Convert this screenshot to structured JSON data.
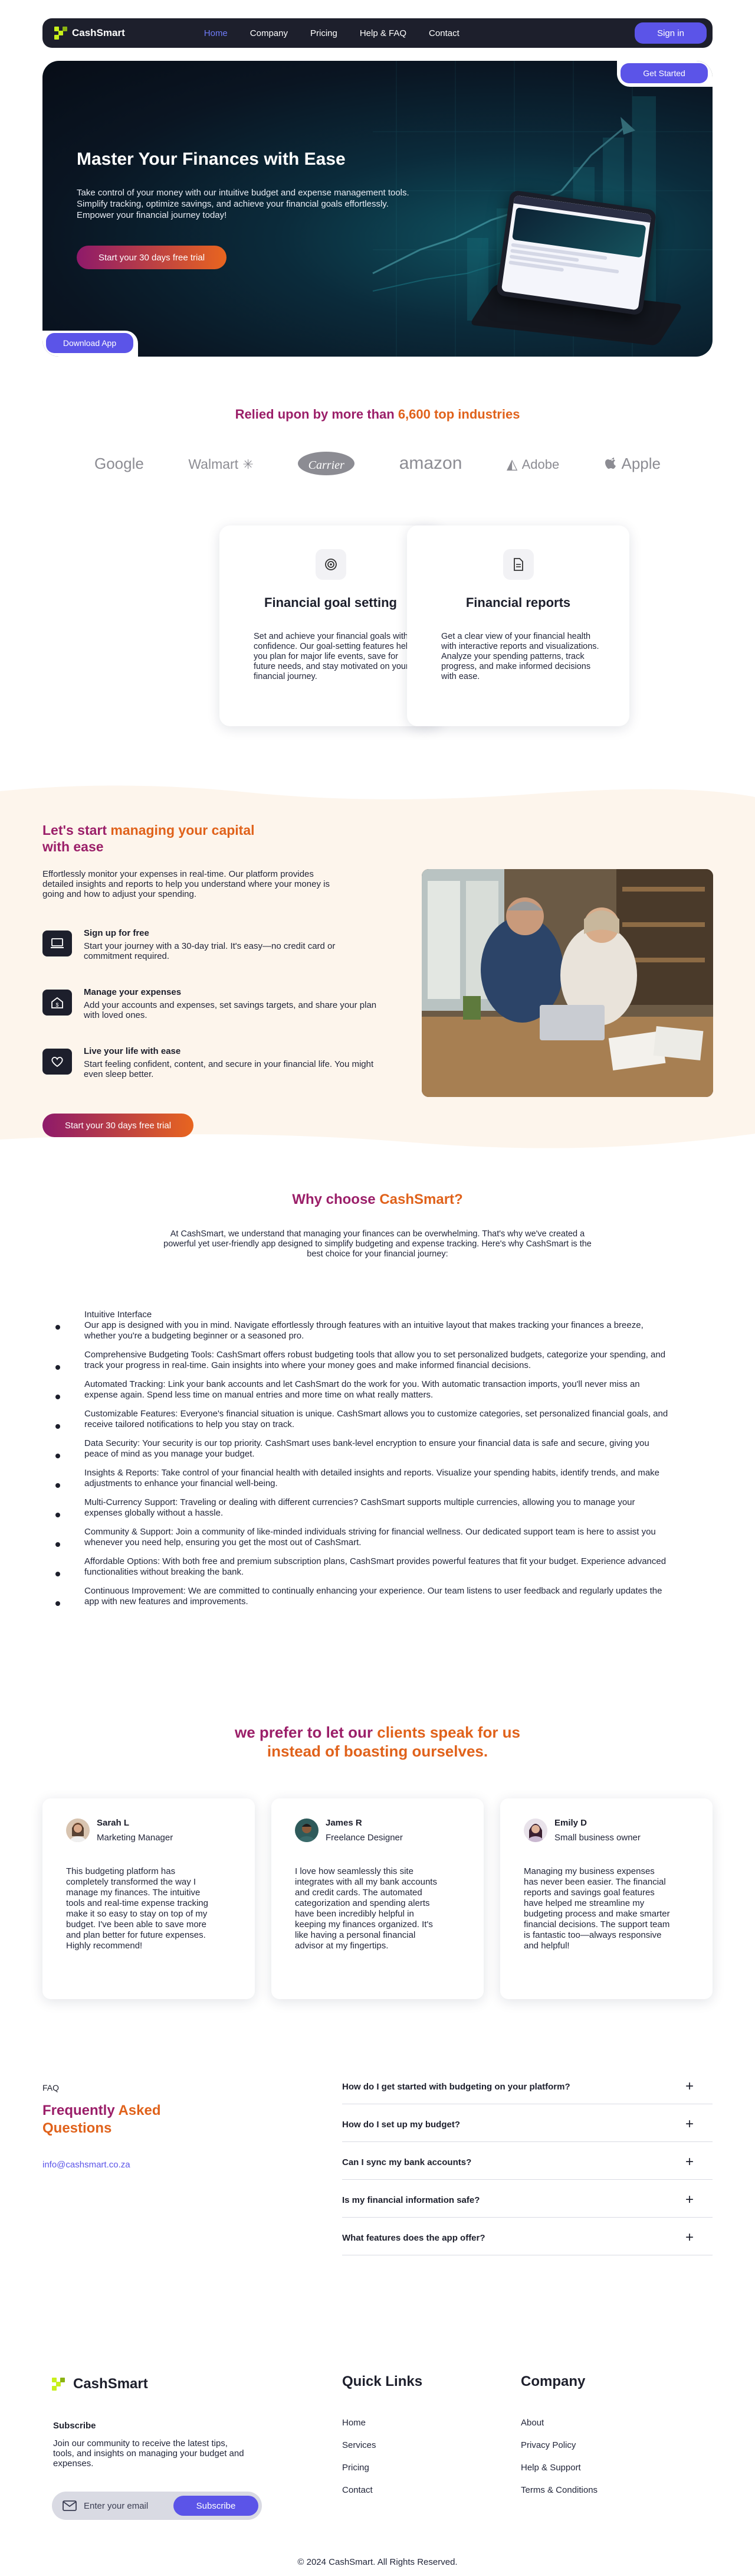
{
  "nav": {
    "brand": "CashSmart",
    "links": [
      "Home",
      "Company",
      "Pricing",
      "Help & FAQ",
      "Contact"
    ],
    "signin": "Sign in"
  },
  "hero": {
    "title": "Master Your Finances with Ease",
    "text": "Take control of your money with our intuitive budget and expense management tools. Simplify tracking, optimize savings, and achieve your financial goals effortlessly. Empower your financial journey today!",
    "cta": "Start your 30 days free trial",
    "get_started": "Get Started",
    "download_app": "Download App"
  },
  "trust": {
    "title_a": "Relied upon by more than ",
    "title_b": "6,600 top industries",
    "logos": [
      "Google",
      "Walmart",
      "Carrier",
      "amazon",
      "Adobe",
      "Apple"
    ]
  },
  "features": [
    {
      "title": "Financial goal setting",
      "text": "Set and achieve your financial goals with confidence. Our goal-setting features help you plan for major life events, save for future needs, and stay motivated on your financial journey.",
      "icon": "target-icon"
    },
    {
      "title": "Financial reports",
      "text": "Get a clear view of your financial health with interactive reports and visualizations. Analyze your spending patterns, track progress, and make informed decisions with ease.",
      "icon": "document-icon"
    }
  ],
  "capital": {
    "title_a": "Let's start ",
    "title_b": "managing your capital",
    "title_c": " with ease",
    "desc": "Effortlessly monitor your expenses in real-time. Our platform provides detailed insights and reports to help you understand where your money is going and how to adjust your spending.",
    "steps": [
      {
        "title": "Sign up for free",
        "text": "Start your journey with a 30-day trial. It's easy—no credit card or commitment required.",
        "icon": "laptop-icon"
      },
      {
        "title": "Manage your expenses",
        "text": "Add your accounts and expenses, set savings targets, and share your plan with loved ones.",
        "icon": "home-dollar-icon"
      },
      {
        "title": "Live your life with ease",
        "text": "Start feeling confident, content, and secure in your financial life. You might even sleep better.",
        "icon": "heart-icon"
      }
    ],
    "cta": "Start your 30 days free trial"
  },
  "why": {
    "title_a": "Why choose ",
    "title_b": "CashSmart?",
    "intro": "At CashSmart, we understand that managing your finances can be overwhelming. That's why we've created a powerful yet user-friendly app designed to simplify budgeting and expense tracking. Here's why CashSmart is the best choice for your financial journey:",
    "items": [
      "Intuitive Interface",
      "Our app is designed with you in mind. Navigate effortlessly through features with an intuitive layout that makes tracking your finances a breeze, whether you're a budgeting beginner or a seasoned pro.",
      "Comprehensive Budgeting Tools: CashSmart offers robust budgeting tools that allow you to set personalized budgets, categorize your spending, and track your progress in real-time. Gain insights into where your money goes and make informed financial decisions.",
      "Automated Tracking: Link your bank accounts and let CashSmart do the work for you. With automatic transaction imports, you'll never miss an expense again. Spend less time on manual entries and more time on what really matters.",
      "Customizable Features: Everyone's financial situation is unique. CashSmart allows you to customize categories, set personalized financial goals, and receive tailored notifications to help you stay on track.",
      "Data Security: Your security is our top priority. CashSmart uses bank-level encryption to ensure your financial data is safe and secure, giving you peace of mind as you manage your budget.",
      "Insights & Reports: Take control of your financial health with detailed insights and reports. Visualize your spending habits, identify trends, and make adjustments to enhance your financial well-being.",
      "Multi-Currency Support: Traveling or dealing with different currencies? CashSmart supports multiple currencies, allowing you to manage your expenses globally without a hassle.",
      "Community & Support: Join a community of like-minded individuals striving for financial wellness. Our dedicated support team is here to assist you whenever you need help, ensuring you get the most out of CashSmart.",
      "Affordable Options: With both free and premium subscription plans, CashSmart provides powerful features that fit your budget. Experience advanced functionalities without breaking the bank.",
      "Continuous Improvement: We are committed to continually enhancing your experience. Our team listens to user feedback and regularly updates the app with new features and improvements."
    ]
  },
  "testimonials": {
    "title_a": "we prefer to let our ",
    "title_b": "clients speak for us",
    "title_c": "instead of boasting ourselves.",
    "cards": [
      {
        "name": "Sarah L",
        "role": "Marketing Manager",
        "quote": "This budgeting platform has completely transformed the way I manage my finances. The intuitive tools and real-time expense tracking make it so easy to stay on top of my budget. I've been able to save more and plan better for future expenses. Highly recommend!"
      },
      {
        "name": "James R",
        "role": "Freelance Designer",
        "quote": "I love how seamlessly this site integrates with all my bank accounts and credit cards. The automated categorization and spending alerts have been incredibly helpful in keeping my finances organized. It's like having a personal financial advisor at my fingertips."
      },
      {
        "name": "Emily D",
        "role": "Small business owner",
        "quote": "Managing my business expenses has never been easier. The financial reports and savings goal features have helped me streamline my budgeting process and make smarter financial decisions. The support team is fantastic too—always responsive and helpful!"
      }
    ]
  },
  "faq": {
    "label": "FAQ",
    "title_a": "Frequently ",
    "title_b": "Asked Questions",
    "email": "info@cashsmart.co.za",
    "questions": [
      "How do I get started with budgeting on your platform?",
      "How do I set up my budget?",
      "Can I sync my bank accounts?",
      "Is my financial information safe?",
      "What features does the app offer?"
    ]
  },
  "footer": {
    "brand": "CashSmart",
    "subscribe_title": "Subscribe",
    "subscribe_text": "Join our community to receive the latest tips, tools, and insights on managing your budget and expenses.",
    "email_placeholder": "Enter your email",
    "subscribe_button": "Subscribe",
    "quick_links_title": "Quick Links",
    "quick_links": [
      "Home",
      "Services",
      "Pricing",
      "Contact"
    ],
    "company_title": "Company",
    "company_links": [
      "About",
      "Privacy Policy",
      "Help & Support",
      "Terms & Conditions"
    ],
    "copyright": "© 2024 CashSmart. All Rights Reserved."
  }
}
